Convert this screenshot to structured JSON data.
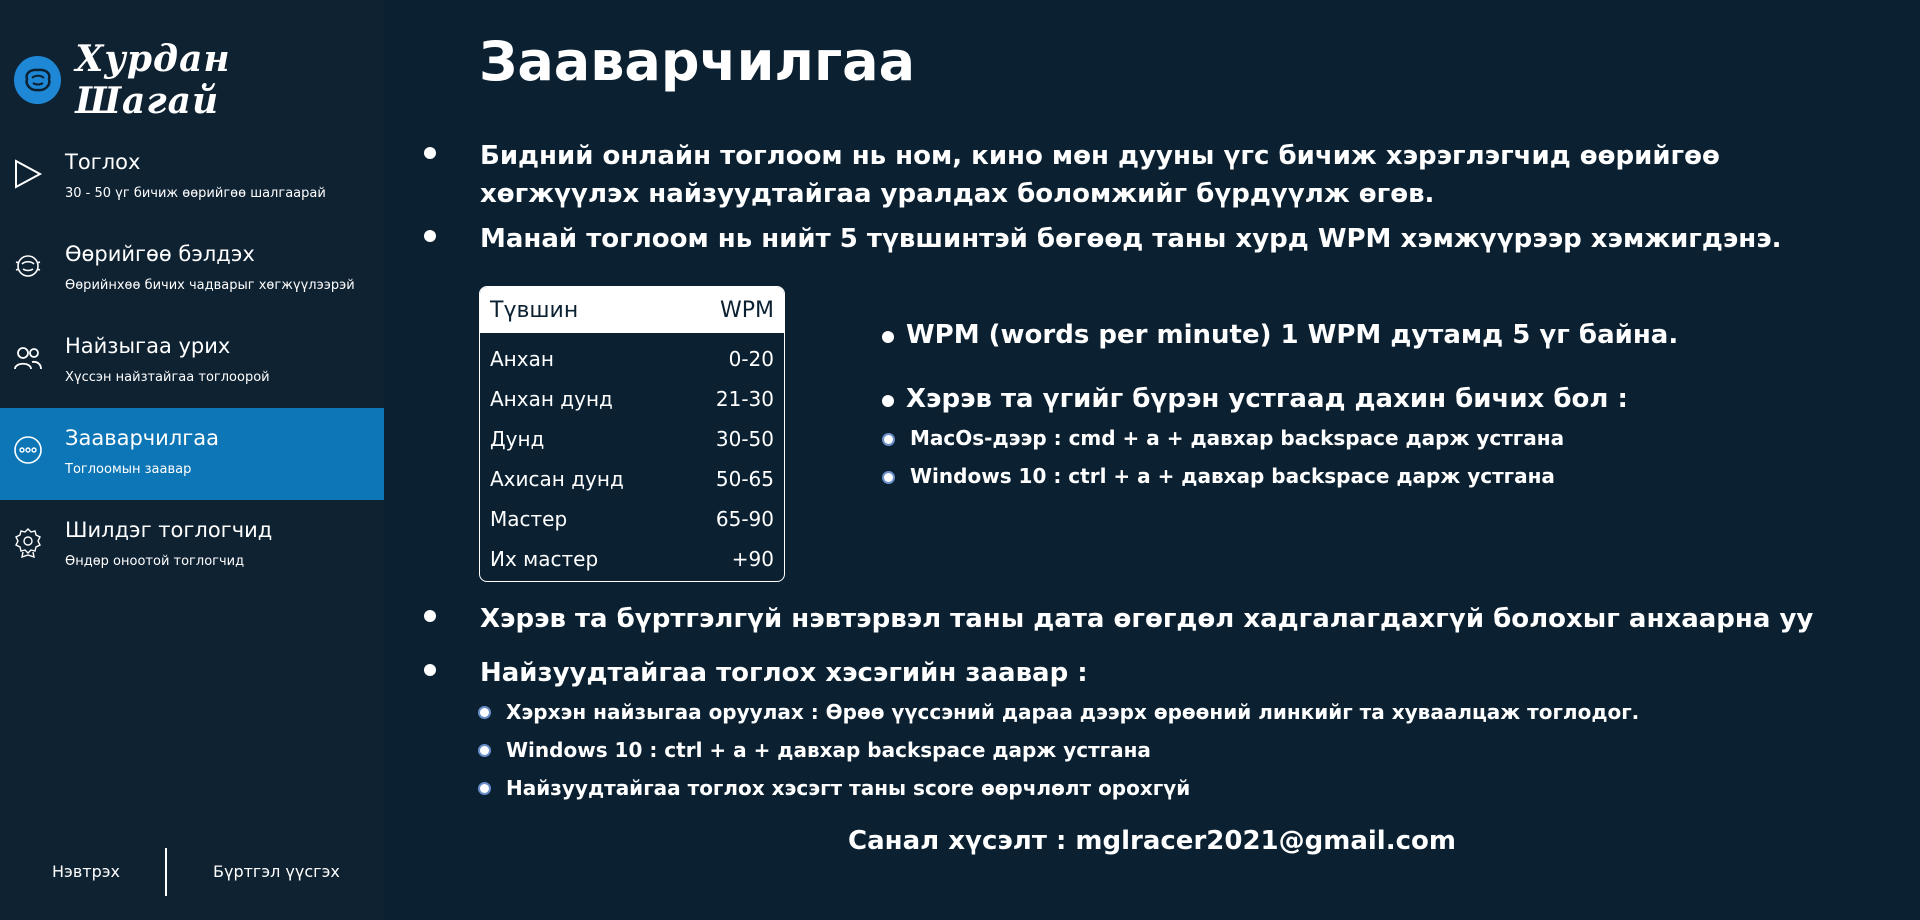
{
  "logo": {
    "text": "Хурдан Шагай",
    "icon": "shagai-logo-icon"
  },
  "sidebar": {
    "items": [
      {
        "title": "Тоглох",
        "subtitle": "30 - 50 үг бичиж өөрийгөө шалгаарай",
        "icon": "play-icon"
      },
      {
        "title": "Өөрийгөө бэлдэх",
        "subtitle": "Өөрийнхөө бичих чадварыг хөгжүүлээрэй",
        "icon": "practice-icon"
      },
      {
        "title": "Найзыгаа урих",
        "subtitle": "Хүссэн найзтайгаа тоглоорой",
        "icon": "friends-icon"
      },
      {
        "title": "Зааварчилгаа",
        "subtitle": "Тоглоомын заавар",
        "icon": "more-icon",
        "active": true
      },
      {
        "title": "Шилдэг тоглогчид",
        "subtitle": "Өндөр оноотой тоглогчид",
        "icon": "award-icon"
      }
    ],
    "login_label": "Нэвтрэх",
    "register_label": "Бүртгэл үүсгэх"
  },
  "main": {
    "title": "Зааварчилгаа",
    "intro_1": "Бидний онлайн тоглоом нь ном, кино мөн дууны үгс бичиж хэрэглэгчид өөрийгөө хөгжүүлэх найзуудтайгаа уралдах боломжийг бүрдүүлж өгөв.",
    "intro_2": "Манай тоглоом нь нийт 5 түвшинтэй бөгөөд таны хурд WPM хэмжүүрээр хэмжигдэнэ.",
    "table": {
      "headers": [
        "Түвшин",
        "WPM"
      ],
      "rows": [
        [
          "Анхан",
          "0-20"
        ],
        [
          "Анхан дунд",
          "21-30"
        ],
        [
          "Дунд",
          "30-50"
        ],
        [
          "Ахисан дунд",
          "50-65"
        ],
        [
          "Мастер",
          "65-90"
        ],
        [
          "Их мастер",
          "+90"
        ]
      ]
    },
    "wpm_note": "WPM (words per minute) 1 WPM дутамд 5 үг байна.",
    "rewrite_title": "Хэрэв та үгийг бүрэн устгаад дахин бичих бол :",
    "rewrite_items": [
      "MacOs-дээр : cmd + a + давхар backspace дарж устгана",
      "Windows 10 : ctrl + a + давхар backspace дарж устгана"
    ],
    "guest_note": "Хэрэв та бүртгэлгүй нэвтэрвэл таны дата өгөгдөл хадгалагдахгүй болохыг анхаарна уу",
    "friends_title": "Найзуудтайгаа тоглох хэсэгийн заавар :",
    "friends_items": [
      "Хэрхэн найзыгаа оруулах : Өрөө үүссэний дараа дээрх өрөөний линкийг та хуваалцаж тоглодог.",
      "Windows 10 : ctrl + a + давхар backspace дарж устгана",
      "Найзуудтайгаа тоглох хэсэгт таны score өөрчлөлт орохгүй"
    ],
    "contact": "Санал хүсэлт : mglracer2021@gmail.com"
  }
}
